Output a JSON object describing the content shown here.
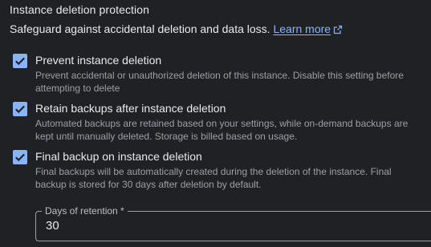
{
  "section": {
    "title": "Instance deletion protection",
    "description": "Safeguard against accidental deletion and data loss.",
    "learn_more": "Learn more"
  },
  "options": [
    {
      "label": "Prevent instance deletion",
      "description": "Prevent accidental or unauthorized deletion of this instance. Disable this setting before attempting to delete",
      "checked": true
    },
    {
      "label": "Retain backups after instance deletion",
      "description": "Automated backups are retained based on your settings, while on-demand backups are kept until manually deleted. Storage is billed based on usage.",
      "checked": true
    },
    {
      "label": "Final backup on instance deletion",
      "description": "Final backups will be automatically created during the deletion of the instance. Final backup is stored for 30 days after deletion by default.",
      "checked": true
    }
  ],
  "retention": {
    "label": "Days of retention *",
    "value": "30"
  },
  "colors": {
    "background": "#202124",
    "accent": "#8ab4f8",
    "text": "#e8eaed",
    "muted_text": "#9aa0a6"
  },
  "icons": {
    "external_link": "open-in-new-icon",
    "check": "checkmark-icon"
  }
}
